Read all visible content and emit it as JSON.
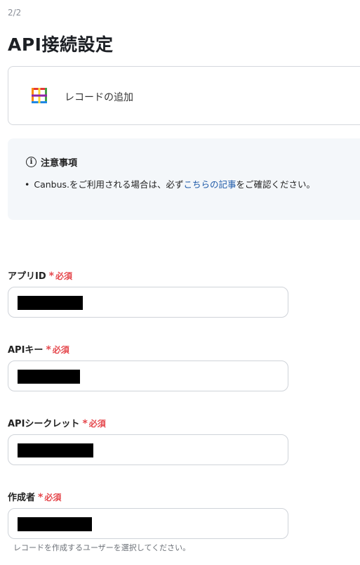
{
  "step": "2/2",
  "title": "API接続設定",
  "app": {
    "action": "レコードの追加",
    "icon": "canbus-logo-icon"
  },
  "notice": {
    "title": "注意事項",
    "text_before": "Canbus.をご利用される場合は、必ず",
    "link": "こちらの記事",
    "text_after": "をご確認ください。"
  },
  "required_label": "必須",
  "fields": [
    {
      "label": "アプリID",
      "value_redacted": true
    },
    {
      "label": "APIキー",
      "value_redacted": true
    },
    {
      "label": "APIシークレット",
      "value_redacted": true
    },
    {
      "label": "作成者",
      "value_redacted": true,
      "hint": "レコードを作成するユーザーを選択してください。"
    }
  ],
  "colors": {
    "required": "#e5484d",
    "link": "#1e5aa8",
    "notice_bg": "#f4f7fa"
  }
}
